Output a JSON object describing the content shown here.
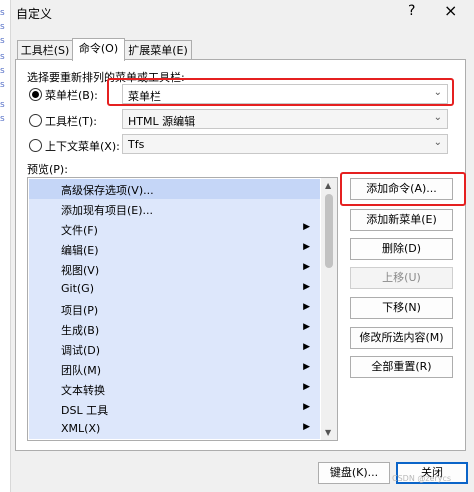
{
  "window": {
    "title": "自定义",
    "help_label": "?",
    "close_label": "×"
  },
  "tabs": [
    {
      "label": "工具栏(S)"
    },
    {
      "label": "命令(O)"
    },
    {
      "label": "扩展菜单(E)"
    }
  ],
  "choose_label": "选择要重新排列的菜单或工具栏:",
  "radios": [
    {
      "label": "菜单栏(B):",
      "selected": true,
      "value": "菜单栏"
    },
    {
      "label": "工具栏(T):",
      "selected": false,
      "value": "HTML 源编辑"
    },
    {
      "label": "上下文菜单(X):",
      "selected": false,
      "value": "Tfs"
    }
  ],
  "preview_label": "预览(P):",
  "items": [
    {
      "label": "高级保存选项(V)...",
      "submenu": false,
      "selected": true
    },
    {
      "label": "添加现有项目(E)...",
      "submenu": false,
      "selected": false
    },
    {
      "label": "文件(F)",
      "submenu": true,
      "selected": false
    },
    {
      "label": "编辑(E)",
      "submenu": true,
      "selected": false
    },
    {
      "label": "视图(V)",
      "submenu": true,
      "selected": false
    },
    {
      "label": "Git(G)",
      "submenu": true,
      "selected": false
    },
    {
      "label": "项目(P)",
      "submenu": true,
      "selected": false
    },
    {
      "label": "生成(B)",
      "submenu": true,
      "selected": false
    },
    {
      "label": "调试(D)",
      "submenu": true,
      "selected": false
    },
    {
      "label": "团队(M)",
      "submenu": true,
      "selected": false
    },
    {
      "label": "文本转换",
      "submenu": true,
      "selected": false
    },
    {
      "label": "DSL 工具",
      "submenu": true,
      "selected": false
    },
    {
      "label": "XML(X)",
      "submenu": true,
      "selected": false
    }
  ],
  "buttons": {
    "add_command": "添加命令(A)...",
    "add_new_menu": "添加新菜单(E)",
    "delete": "删除(D)",
    "move_up": "上移(U)",
    "move_down": "下移(N)",
    "modify_selection": "修改所选内容(M)",
    "reset_all": "全部重置(R)",
    "keyboard": "键盘(K)...",
    "close": "关闭"
  },
  "icons": {
    "submenu_arrow": "▶",
    "dropdown": "⌄",
    "scroll_up": "▲",
    "scroll_down": "▼"
  },
  "colors": {
    "highlight_box": "#e52020",
    "list_item_bg": "#dde7fb",
    "primary_border": "#0a64c8"
  },
  "watermark": "CSDN @zerycs"
}
